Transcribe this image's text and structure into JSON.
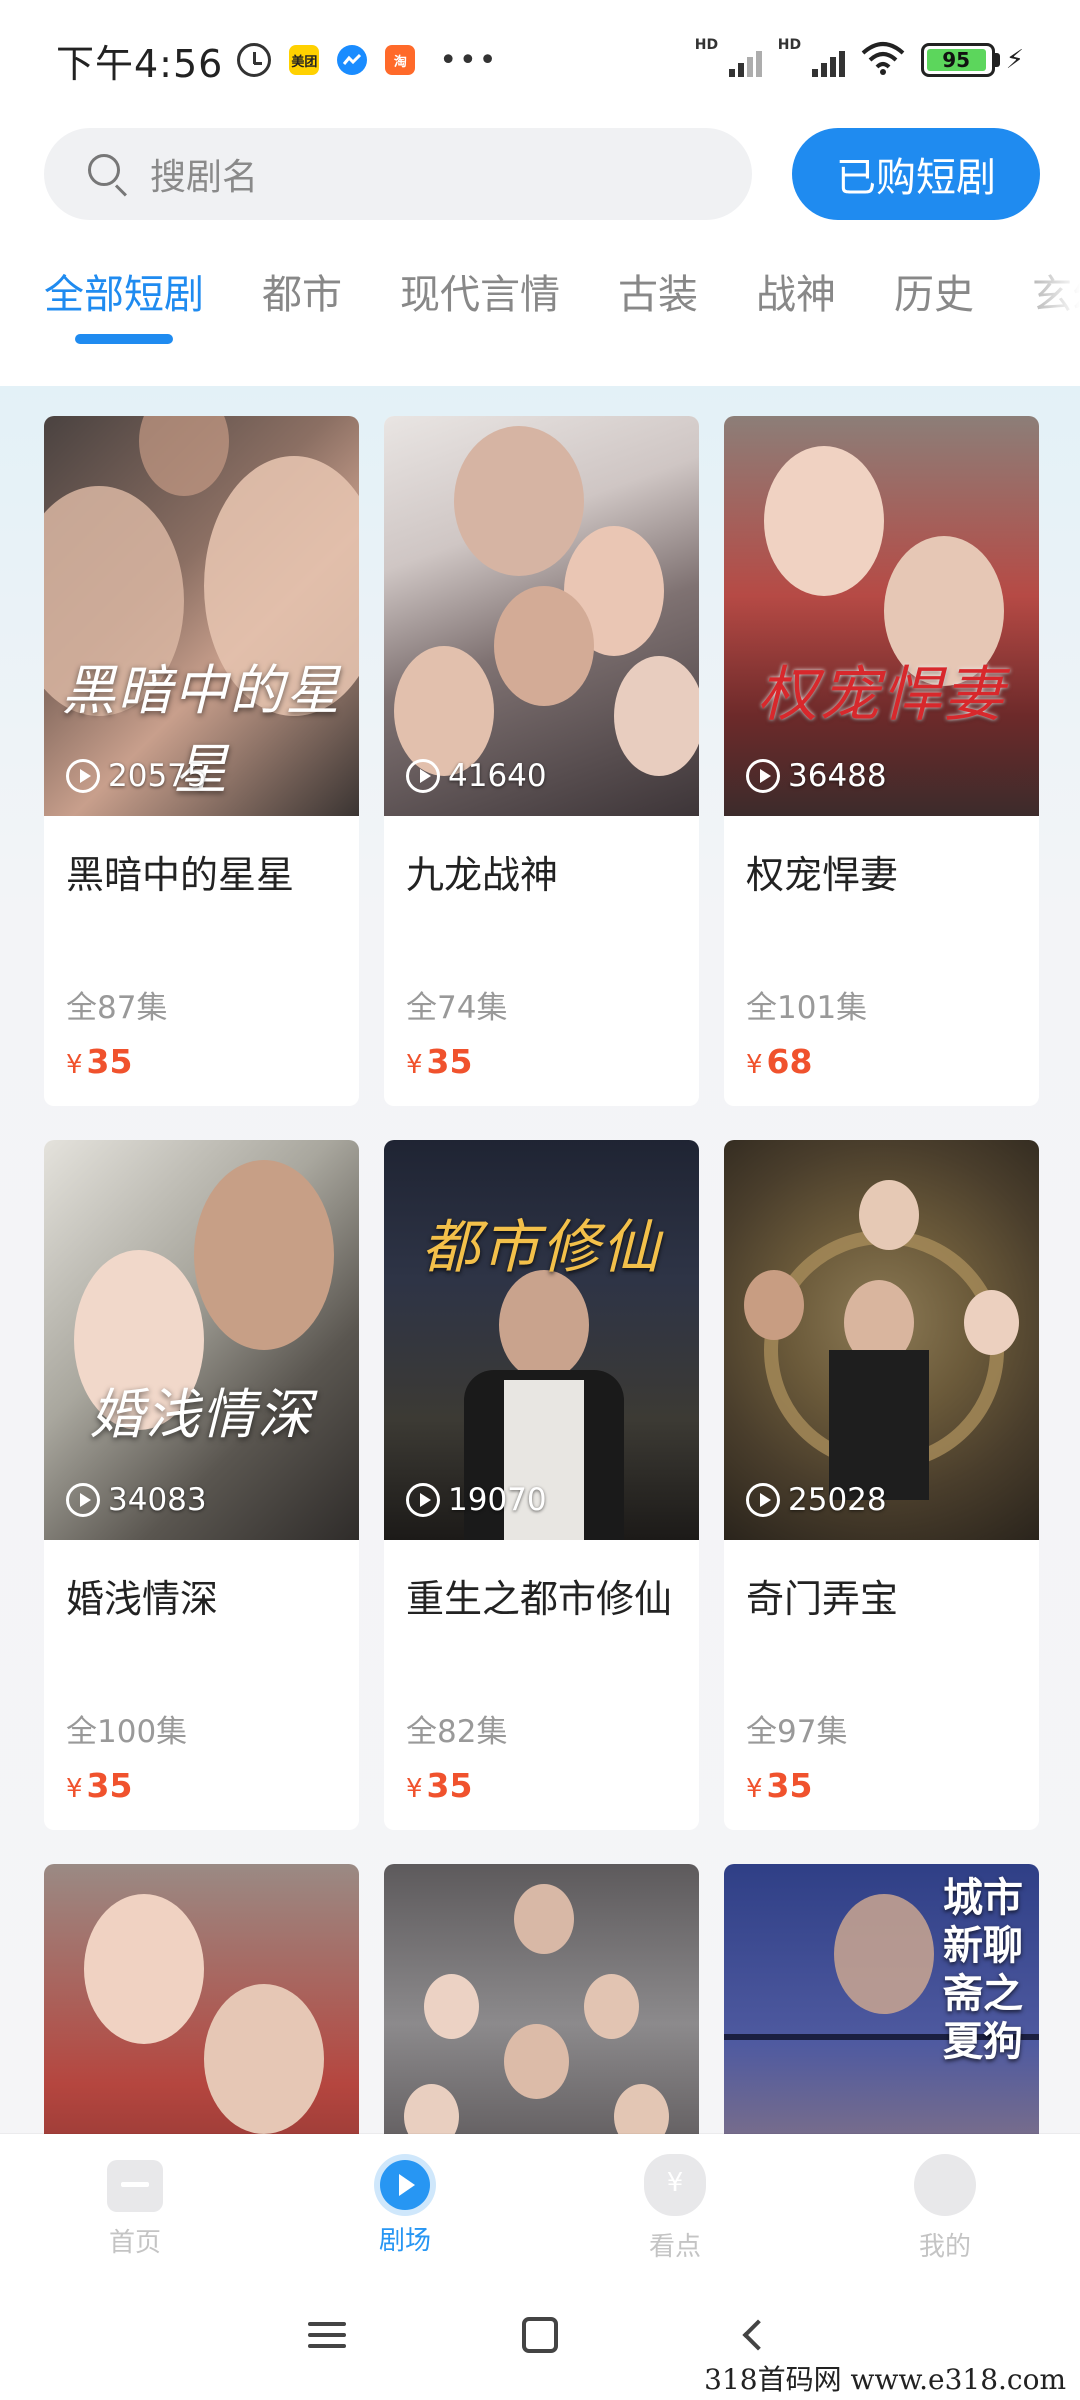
{
  "status_bar": {
    "time": "下午4:56",
    "battery_level": "95",
    "app_badges": [
      "美团",
      "",
      "淘"
    ],
    "signal_label": "HD"
  },
  "search": {
    "placeholder": "搜剧名",
    "purchased_button": "已购短剧"
  },
  "tabs": [
    {
      "label": "全部短剧",
      "active": true
    },
    {
      "label": "都市",
      "active": false
    },
    {
      "label": "现代言情",
      "active": false
    },
    {
      "label": "古装",
      "active": false
    },
    {
      "label": "战神",
      "active": false
    },
    {
      "label": "历史",
      "active": false
    },
    {
      "label": "玄幻",
      "active": false
    }
  ],
  "dramas": [
    {
      "title": "黑暗中的星星",
      "poster_text": "黑暗中的星星",
      "views": "20575",
      "episodes": "全87集",
      "currency": "¥",
      "price": "35"
    },
    {
      "title": "九龙战神",
      "poster_text": "",
      "views": "41640",
      "episodes": "全74集",
      "currency": "¥",
      "price": "35"
    },
    {
      "title": "权宠悍妻",
      "poster_text": "权宠悍妻",
      "views": "36488",
      "episodes": "全101集",
      "currency": "¥",
      "price": "68"
    },
    {
      "title": "婚浅情深",
      "poster_text": "婚浅情深",
      "views": "34083",
      "episodes": "全100集",
      "currency": "¥",
      "price": "35"
    },
    {
      "title": "重生之都市修仙",
      "poster_text": "都市修仙",
      "views": "19070",
      "episodes": "全82集",
      "currency": "¥",
      "price": "35"
    },
    {
      "title": "奇门弄宝",
      "poster_text": "",
      "views": "25028",
      "episodes": "全97集",
      "currency": "¥",
      "price": "35"
    }
  ],
  "partial_posters": [
    {
      "poster_text": ""
    },
    {
      "poster_text": ""
    },
    {
      "poster_text": "城市新聊斋之夏狗"
    }
  ],
  "bottom_nav": [
    {
      "label": "首页",
      "icon": "home-icon",
      "active": false
    },
    {
      "label": "剧场",
      "icon": "theater-icon",
      "active": true
    },
    {
      "label": "看点",
      "icon": "money-bag-icon",
      "active": false
    },
    {
      "label": "我的",
      "icon": "profile-icon",
      "active": false
    }
  ],
  "watermark": "318首码网 www.e318.com",
  "colors": {
    "accent": "#1f8bf0",
    "price": "#f0522d",
    "tab_inactive": "#888888"
  }
}
